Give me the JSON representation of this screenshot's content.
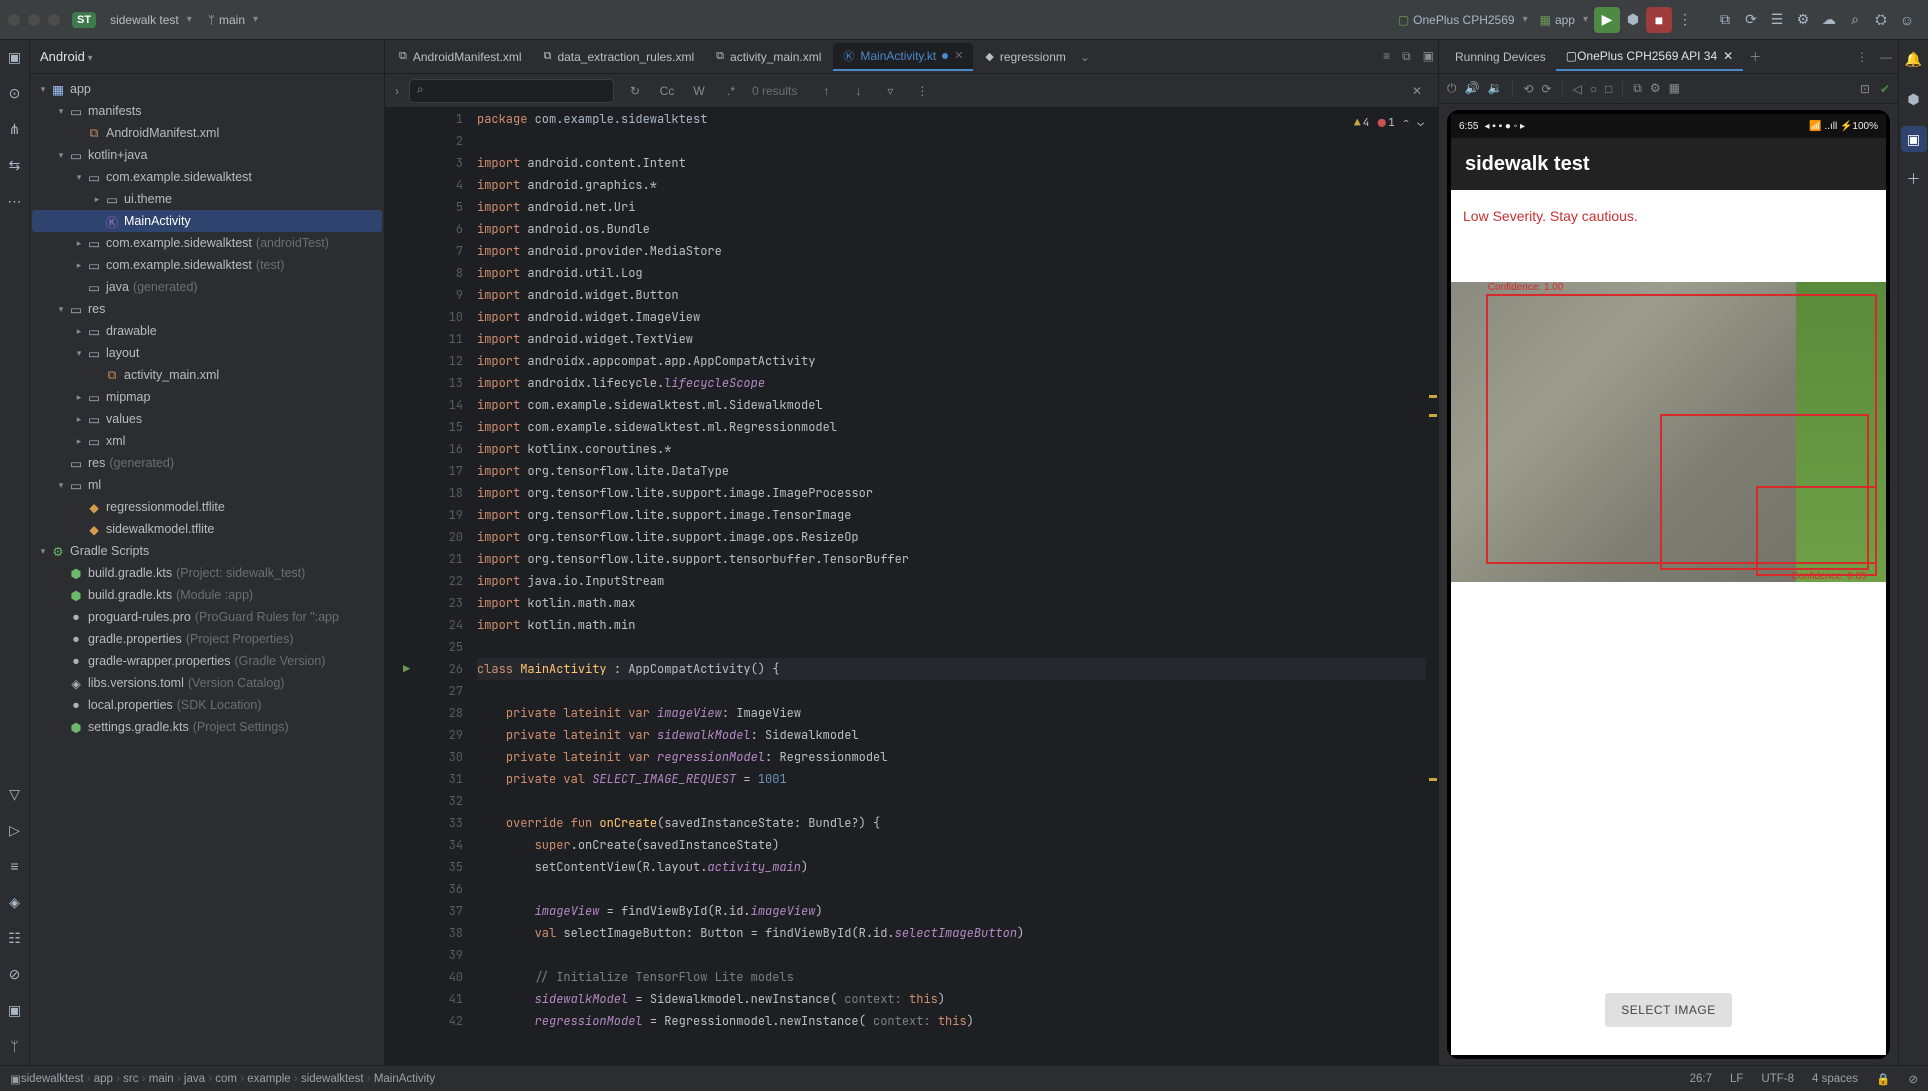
{
  "titlebar": {
    "project_badge": "ST",
    "project_name": "sidewalk test",
    "vcs_branch": "main",
    "device_name": "OnePlus CPH2569",
    "run_config": "app"
  },
  "project_view": {
    "header": "Android",
    "tree": [
      {
        "lvl": 0,
        "arrow": "▾",
        "icon": "▦",
        "iconCls": "ico-mod",
        "label": "app"
      },
      {
        "lvl": 1,
        "arrow": "▾",
        "icon": "▭",
        "iconCls": "ico-dir",
        "label": "manifests"
      },
      {
        "lvl": 2,
        "arrow": "",
        "icon": "⧉",
        "iconCls": "ico-xml",
        "label": "AndroidManifest.xml"
      },
      {
        "lvl": 1,
        "arrow": "▾",
        "icon": "▭",
        "iconCls": "ico-dir",
        "label": "kotlin+java"
      },
      {
        "lvl": 2,
        "arrow": "▾",
        "icon": "▭",
        "iconCls": "ico-dir",
        "label": "com.example.sidewalktest"
      },
      {
        "lvl": 3,
        "arrow": "▸",
        "icon": "▭",
        "iconCls": "ico-dir",
        "label": "ui.theme"
      },
      {
        "lvl": 3,
        "arrow": "",
        "icon": "Ⓚ",
        "iconCls": "ico-kt",
        "label": "MainActivity",
        "sel": true
      },
      {
        "lvl": 2,
        "arrow": "▸",
        "icon": "▭",
        "iconCls": "ico-dir",
        "label": "com.example.sidewalktest",
        "hint": "(androidTest)"
      },
      {
        "lvl": 2,
        "arrow": "▸",
        "icon": "▭",
        "iconCls": "ico-dir",
        "label": "com.example.sidewalktest",
        "hint": "(test)"
      },
      {
        "lvl": 2,
        "arrow": "",
        "icon": "▭",
        "iconCls": "ico-dir",
        "label": "java",
        "hint": "(generated)"
      },
      {
        "lvl": 1,
        "arrow": "▾",
        "icon": "▭",
        "iconCls": "ico-dir",
        "label": "res"
      },
      {
        "lvl": 2,
        "arrow": "▸",
        "icon": "▭",
        "iconCls": "ico-dir",
        "label": "drawable"
      },
      {
        "lvl": 2,
        "arrow": "▾",
        "icon": "▭",
        "iconCls": "ico-dir",
        "label": "layout"
      },
      {
        "lvl": 3,
        "arrow": "",
        "icon": "⧉",
        "iconCls": "ico-xml",
        "label": "activity_main.xml"
      },
      {
        "lvl": 2,
        "arrow": "▸",
        "icon": "▭",
        "iconCls": "ico-dir",
        "label": "mipmap"
      },
      {
        "lvl": 2,
        "arrow": "▸",
        "icon": "▭",
        "iconCls": "ico-dir",
        "label": "values"
      },
      {
        "lvl": 2,
        "arrow": "▸",
        "icon": "▭",
        "iconCls": "ico-dir",
        "label": "xml"
      },
      {
        "lvl": 1,
        "arrow": "",
        "icon": "▭",
        "iconCls": "ico-dir",
        "label": "res",
        "hint": "(generated)"
      },
      {
        "lvl": 1,
        "arrow": "▾",
        "icon": "▭",
        "iconCls": "ico-dir",
        "label": "ml"
      },
      {
        "lvl": 2,
        "arrow": "",
        "icon": "◆",
        "iconCls": "ico-tf",
        "label": "regressionmodel.tflite"
      },
      {
        "lvl": 2,
        "arrow": "",
        "icon": "◆",
        "iconCls": "ico-tf",
        "label": "sidewalkmodel.tflite"
      },
      {
        "lvl": 0,
        "arrow": "▾",
        "icon": "⚙",
        "iconCls": "ico-gradle",
        "label": "Gradle Scripts"
      },
      {
        "lvl": 1,
        "arrow": "",
        "icon": "⬢",
        "iconCls": "ico-gradle",
        "label": "build.gradle.kts",
        "hint": "(Project: sidewalk_test)"
      },
      {
        "lvl": 1,
        "arrow": "",
        "icon": "⬢",
        "iconCls": "ico-gradle",
        "label": "build.gradle.kts",
        "hint": "(Module :app)"
      },
      {
        "lvl": 1,
        "arrow": "",
        "icon": "●",
        "iconCls": "ico-prop",
        "label": "proguard-rules.pro",
        "hint": "(ProGuard Rules for \":app"
      },
      {
        "lvl": 1,
        "arrow": "",
        "icon": "●",
        "iconCls": "ico-prop",
        "label": "gradle.properties",
        "hint": "(Project Properties)"
      },
      {
        "lvl": 1,
        "arrow": "",
        "icon": "●",
        "iconCls": "ico-prop",
        "label": "gradle-wrapper.properties",
        "hint": "(Gradle Version)"
      },
      {
        "lvl": 1,
        "arrow": "",
        "icon": "◈",
        "iconCls": "ico-prop",
        "label": "libs.versions.toml",
        "hint": "(Version Catalog)"
      },
      {
        "lvl": 1,
        "arrow": "",
        "icon": "●",
        "iconCls": "ico-prop",
        "label": "local.properties",
        "hint": "(SDK Location)"
      },
      {
        "lvl": 1,
        "arrow": "",
        "icon": "⬢",
        "iconCls": "ico-gradle",
        "label": "settings.gradle.kts",
        "hint": "(Project Settings)"
      }
    ]
  },
  "editor_tabs": [
    {
      "icon": "⧉",
      "label": "AndroidManifest.xml"
    },
    {
      "icon": "⧉",
      "label": "data_extraction_rules.xml"
    },
    {
      "icon": "⧉",
      "label": "activity_main.xml"
    },
    {
      "icon": "Ⓚ",
      "label": "MainActivity.kt",
      "active": true,
      "closeable": true
    },
    {
      "icon": "◆",
      "label": "regressionm"
    }
  ],
  "findbar": {
    "placeholder": "",
    "results": "0 results",
    "cc": "Cc",
    "word": "W",
    "regex": ".*"
  },
  "inspections": {
    "warn": "4",
    "err": "1"
  },
  "code": {
    "first_line": 1,
    "lines": [
      {
        "n": 1,
        "html": "<span class='kw'>package</span> <span class='pkg'>com.example.sidewalktest</span>"
      },
      {
        "n": 2,
        "html": ""
      },
      {
        "n": 3,
        "html": "<span class='kw'>import</span> android.content.Intent"
      },
      {
        "n": 4,
        "html": "<span class='kw'>import</span> android.graphics.*"
      },
      {
        "n": 5,
        "html": "<span class='kw'>import</span> android.net.Uri"
      },
      {
        "n": 6,
        "html": "<span class='kw'>import</span> android.os.Bundle"
      },
      {
        "n": 7,
        "html": "<span class='kw'>import</span> android.provider.MediaStore"
      },
      {
        "n": 8,
        "html": "<span class='kw'>import</span> android.util.Log"
      },
      {
        "n": 9,
        "html": "<span class='kw'>import</span> android.widget.Button"
      },
      {
        "n": 10,
        "html": "<span class='kw'>import</span> android.widget.ImageView"
      },
      {
        "n": 11,
        "html": "<span class='kw'>import</span> android.widget.TextView"
      },
      {
        "n": 12,
        "html": "<span class='kw'>import</span> androidx.appcompat.app.AppCompatActivity"
      },
      {
        "n": 13,
        "html": "<span class='kw'>import</span> androidx.lifecycle.<span class='it'>lifecycleScope</span>"
      },
      {
        "n": 14,
        "html": "<span class='kw'>import</span> com.example.sidewalktest.ml.Sidewalkmodel"
      },
      {
        "n": 15,
        "html": "<span class='kw'>import</span> com.example.sidewalktest.ml.Regressionmodel"
      },
      {
        "n": 16,
        "html": "<span class='kw'>import</span> kotlinx.coroutines.*"
      },
      {
        "n": 17,
        "html": "<span class='kw'>import</span> org.tensorflow.lite.DataType"
      },
      {
        "n": 18,
        "html": "<span class='kw'>import</span> org.tensorflow.lite.support.image.ImageProcessor"
      },
      {
        "n": 19,
        "html": "<span class='kw'>import</span> org.tensorflow.lite.support.image.TensorImage"
      },
      {
        "n": 20,
        "html": "<span class='kw'>import</span> org.tensorflow.lite.support.image.ops.ResizeOp"
      },
      {
        "n": 21,
        "html": "<span class='kw'>import</span> org.tensorflow.lite.support.tensorbuffer.TensorBuffer"
      },
      {
        "n": 22,
        "html": "<span class='kw'>import</span> java.io.InputStream"
      },
      {
        "n": 23,
        "html": "<span class='kw'>import</span> kotlin.math.max"
      },
      {
        "n": 24,
        "html": "<span class='kw'>import</span> kotlin.math.min"
      },
      {
        "n": 25,
        "html": ""
      },
      {
        "n": 26,
        "html": "<span class='kw'>class</span> <span class='fn'>MainActivity</span> : AppCompatActivity() {",
        "caret": true,
        "run": true
      },
      {
        "n": 27,
        "html": ""
      },
      {
        "n": 28,
        "html": "    <span class='kw'>private lateinit var</span> <span class='it'>imageView</span>: ImageView"
      },
      {
        "n": 29,
        "html": "    <span class='kw'>private lateinit var</span> <span class='it'>sidewalkModel</span>: Sidewalkmodel"
      },
      {
        "n": 30,
        "html": "    <span class='kw'>private lateinit var</span> <span class='it'>regressionModel</span>: Regressionmodel"
      },
      {
        "n": 31,
        "html": "    <span class='kw'>private val</span> <span class='it'>SELECT_IMAGE_REQUEST</span> = <span class='num'>1001</span>"
      },
      {
        "n": 32,
        "html": ""
      },
      {
        "n": 33,
        "html": "    <span class='kw'>override fun</span> <span class='fn'>onCreate</span>(savedInstanceState: Bundle?) {"
      },
      {
        "n": 34,
        "html": "        <span class='kw'>super</span>.onCreate(savedInstanceState)"
      },
      {
        "n": 35,
        "html": "        setContentView(R.layout.<span class='it'>activity_main</span>)"
      },
      {
        "n": 36,
        "html": ""
      },
      {
        "n": 37,
        "html": "        <span class='it'>imageView</span> = findViewById(R.id.<span class='it'>imageView</span>)"
      },
      {
        "n": 38,
        "html": "        <span class='kw'>val</span> selectImageButton: Button = findViewById(R.id.<span class='it'>selectImageButton</span>)"
      },
      {
        "n": 39,
        "html": ""
      },
      {
        "n": 40,
        "html": "        <span class='com'>// Initialize TensorFlow Lite models</span>"
      },
      {
        "n": 41,
        "html": "        <span class='it'>sidewalkModel</span> = Sidewalkmodel.newInstance( <span class='com'>context:</span> <span class='kw'>this</span>)"
      },
      {
        "n": 42,
        "html": "        <span class='it'>regressionModel</span> = Regressionmodel.newInstance( <span class='com'>context:</span> <span class='kw'>this</span>)"
      }
    ]
  },
  "device_panel": {
    "tab_running": "Running Devices",
    "tab_device": "OnePlus CPH2569 API 34",
    "status_time": "6:55",
    "status_battery": "100%",
    "app_title": "sidewalk test",
    "severity_text": "Low Severity. Stay cautious.",
    "select_button": "SELECT IMAGE",
    "det1": "Confidence: 1.00",
    "det2": "Confidence: 0.85"
  },
  "breadcrumbs": [
    "sidewalktest",
    "app",
    "src",
    "main",
    "java",
    "com",
    "example",
    "sidewalktest",
    "MainActivity"
  ],
  "statusbar": {
    "pos": "26:7",
    "sep": "LF",
    "enc": "UTF-8",
    "indent": "4 spaces"
  }
}
